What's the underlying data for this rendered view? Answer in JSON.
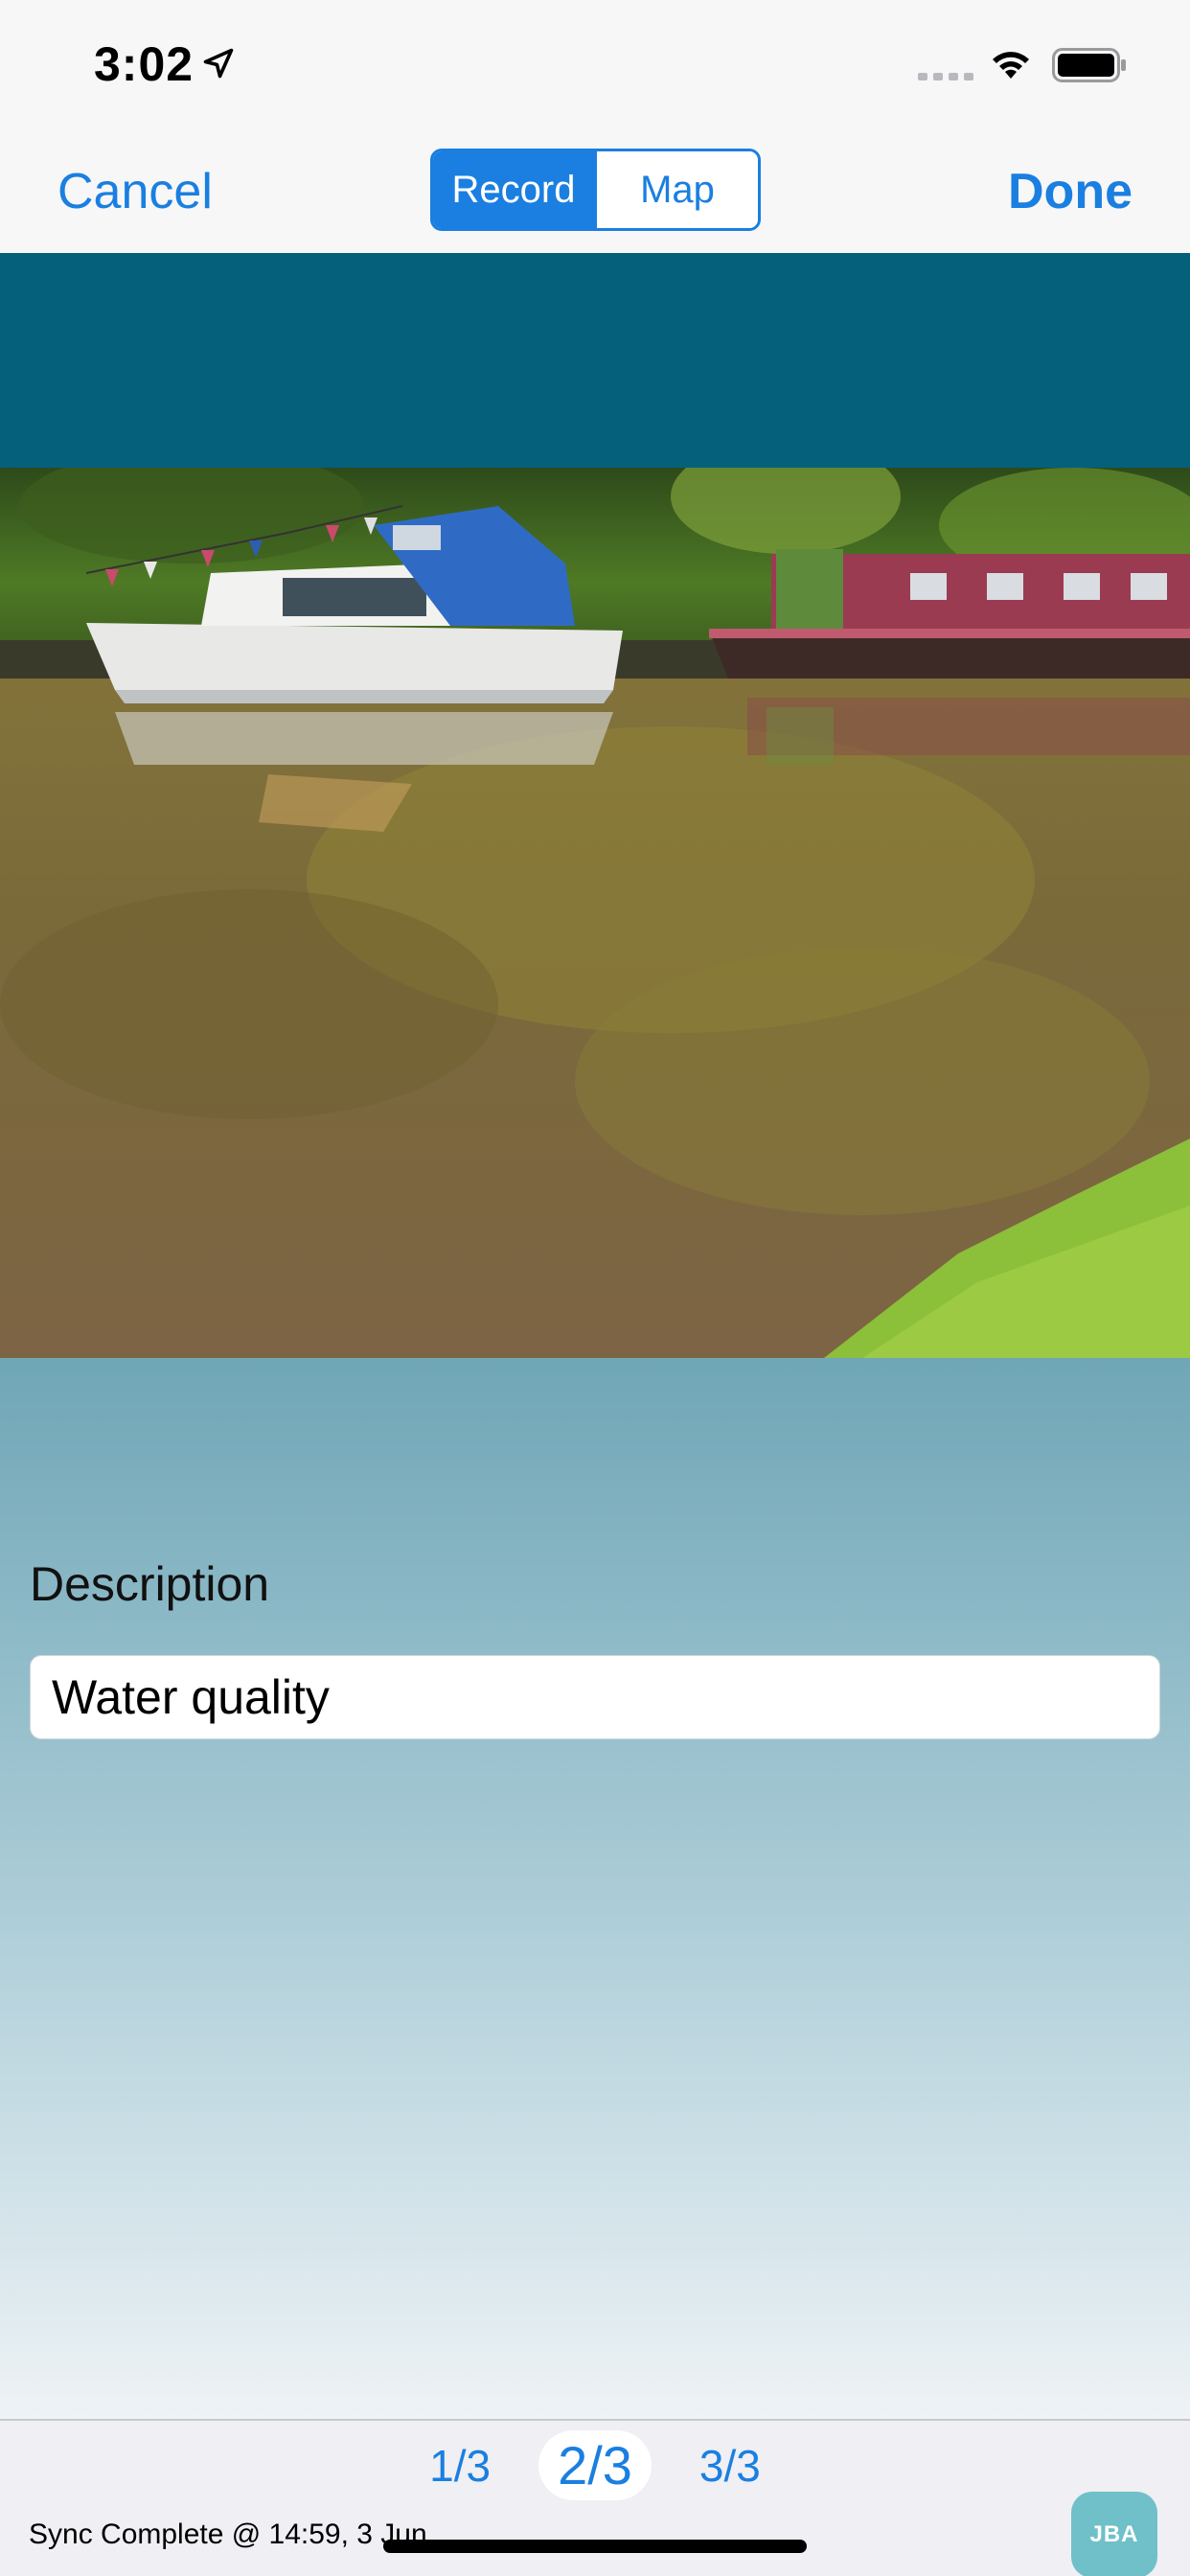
{
  "status_bar": {
    "time": "3:02"
  },
  "nav": {
    "cancel_label": "Cancel",
    "done_label": "Done",
    "segments": [
      {
        "label": "Record",
        "selected": true
      },
      {
        "label": "Map",
        "selected": false
      }
    ]
  },
  "form": {
    "description_label": "Description",
    "description_value": "Water quality"
  },
  "pager": {
    "pages": [
      "1/3",
      "2/3",
      "3/3"
    ],
    "current": "2/3"
  },
  "footer": {
    "sync_status": "Sync Complete @ 14:59, 3 Jun",
    "logo_text": "JBA"
  },
  "colors": {
    "accent": "#1a7fe0",
    "header_teal": "#05607c"
  },
  "icons": [
    "location-arrow-icon",
    "signal-icon",
    "wifi-icon",
    "battery-icon"
  ]
}
